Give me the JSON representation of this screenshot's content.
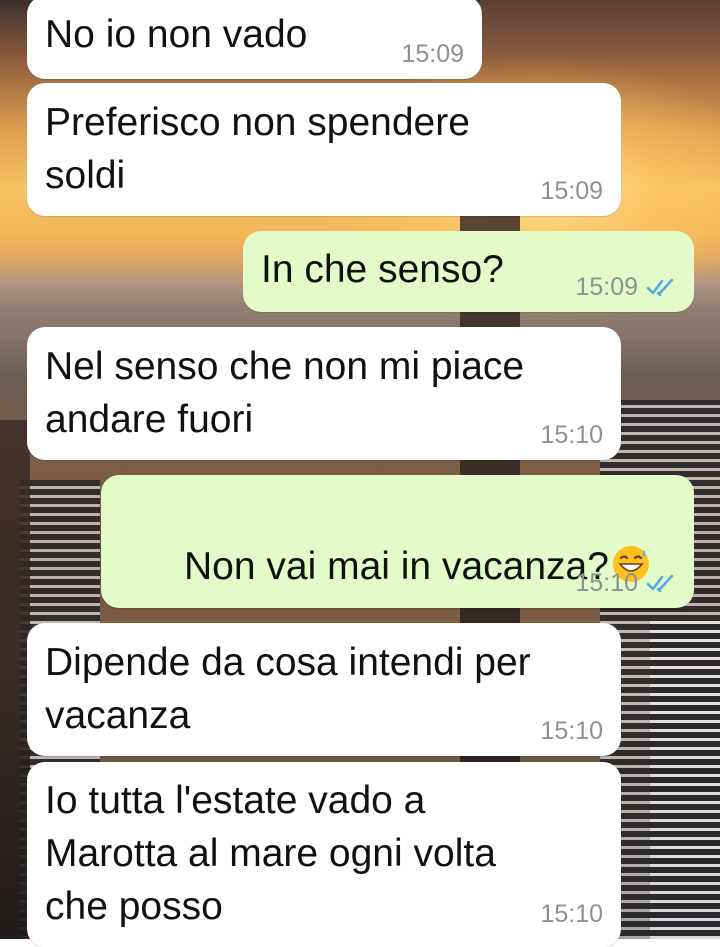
{
  "messages": [
    {
      "direction": "in",
      "text": "No io non vado",
      "time": "15:09"
    },
    {
      "direction": "in",
      "text": "Preferisco non spendere\nsoldi",
      "time": "15:09"
    },
    {
      "direction": "out",
      "text": "In che senso?",
      "time": "15:09",
      "status": "read"
    },
    {
      "direction": "in",
      "text": "Nel senso che non mi piace\nandare fuori",
      "time": "15:10"
    },
    {
      "direction": "out",
      "text": "Non vai mai in vacanza?",
      "emoji": "grinning-face-with-sweat",
      "time": "15:10",
      "status": "read"
    },
    {
      "direction": "in",
      "text": "Dipende da cosa intendi per\nvacanza",
      "time": "15:10"
    },
    {
      "direction": "in",
      "text": "Io tutta l'estate vado a\nMarotta al mare ogni volta\nche posso",
      "time": "15:10"
    }
  ],
  "colors": {
    "incoming_bubble": "#ffffff",
    "outgoing_bubble": "#e2fbc8",
    "read_ticks": "#4fa9e6",
    "timestamp": "#8c9196"
  },
  "icons": {
    "read_receipt": "double-check-icon"
  }
}
